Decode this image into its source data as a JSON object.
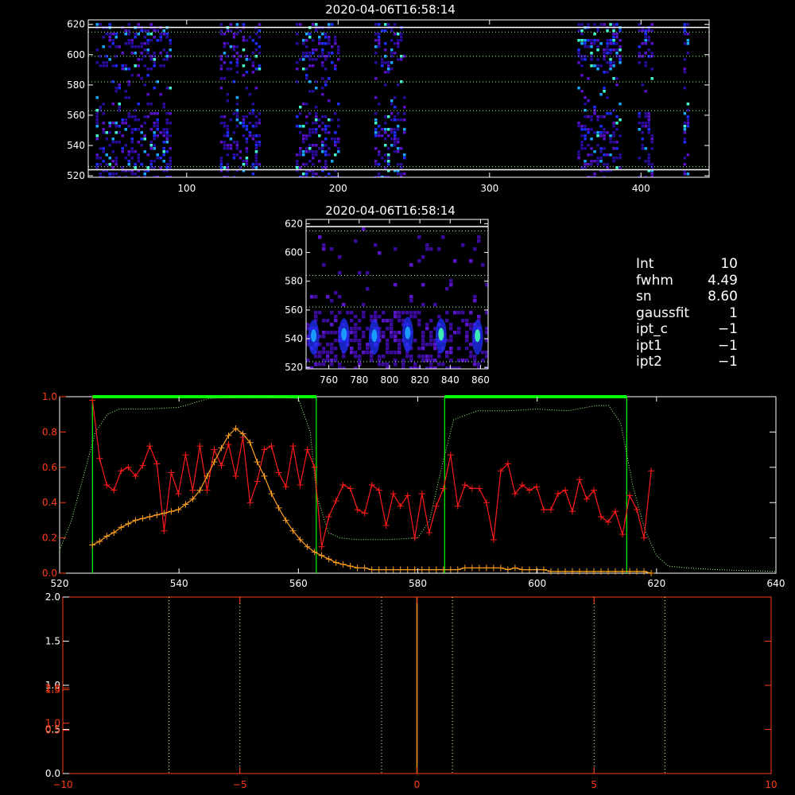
{
  "colors": {
    "white": "#ffffff",
    "red_axis": "#ff3c14",
    "red_series": "#ff1a1a",
    "orange_series": "#ffa01e",
    "green": "#00ff00",
    "grid_dotted": "#ffffa0"
  },
  "panel_top": {
    "title": "2020-04-06T16:58:14",
    "chart_data": {
      "type": "heatmap",
      "xlim": [
        35,
        445
      ],
      "ylim": [
        519,
        623
      ],
      "xticks": [
        100,
        200,
        300,
        400
      ],
      "yticks": [
        520,
        540,
        560,
        580,
        600,
        620
      ],
      "column_bands": [
        [
          40,
          90
        ],
        [
          122,
          148
        ],
        [
          172,
          200
        ],
        [
          224,
          244
        ],
        [
          358,
          386
        ],
        [
          398,
          408
        ],
        [
          428,
          431
        ]
      ],
      "gaps_y": [
        [
          563,
          591
        ]
      ],
      "hlines_solid": [
        618,
        524
      ],
      "hlines_dotted": [
        615,
        599,
        582,
        563,
        526
      ]
    }
  },
  "panel_mid": {
    "title": "2020-04-06T16:58:14",
    "chart_data": {
      "type": "heatmap",
      "xlim": [
        745,
        865
      ],
      "ylim": [
        519,
        623
      ],
      "xticks": [
        760,
        780,
        800,
        820,
        840,
        860
      ],
      "yticks": [
        520,
        540,
        560,
        580,
        600,
        620
      ],
      "bright_spots": [
        [
          750,
          541
        ],
        [
          770,
          542
        ],
        [
          790,
          541
        ],
        [
          812,
          543
        ],
        [
          834,
          542
        ],
        [
          858,
          541
        ]
      ],
      "hlines_solid": [
        618
      ],
      "hlines_dotted": [
        615,
        584,
        562,
        524
      ]
    }
  },
  "info_lines": [
    {
      "key": "Int",
      "val": "10"
    },
    {
      "key": "fwhm",
      "val": "4.49"
    },
    {
      "key": "sn",
      "val": "8.60"
    },
    {
      "key": "gaussfit",
      "val": "1"
    },
    {
      "key": "ipt_c",
      "val": "−1"
    },
    {
      "key": "ipt1",
      "val": "−1"
    },
    {
      "key": "ipt2",
      "val": "−1"
    }
  ],
  "panel_spec": {
    "chart_data": {
      "type": "line",
      "xlim": [
        520,
        640
      ],
      "ylim": [
        0,
        1.0
      ],
      "xticks": [
        520,
        540,
        560,
        580,
        600,
        620,
        640
      ],
      "yticks": [
        0.0,
        0.2,
        0.4,
        0.6,
        0.8,
        1.0
      ],
      "ytick_labels": [
        "0.0",
        "0.2",
        "0.4",
        "0.6",
        "0.8",
        "1.0"
      ],
      "green_windows": [
        [
          525.5,
          563
        ],
        [
          584.5,
          615
        ]
      ],
      "green_dotted": {
        "x": [
          520,
          522,
          524,
          526,
          528,
          530,
          535,
          540,
          545,
          550,
          555,
          560,
          562,
          563,
          565,
          567,
          570,
          575,
          580,
          582,
          584,
          586,
          590,
          595,
          600,
          605,
          610,
          612,
          614,
          616,
          618,
          620,
          622,
          625,
          630,
          640
        ],
        "y": [
          0.13,
          0.3,
          0.55,
          0.8,
          0.9,
          0.93,
          0.93,
          0.94,
          0.99,
          1.0,
          1.0,
          0.99,
          0.8,
          0.45,
          0.23,
          0.2,
          0.19,
          0.19,
          0.2,
          0.3,
          0.6,
          0.87,
          0.92,
          0.92,
          0.93,
          0.92,
          0.95,
          0.95,
          0.85,
          0.5,
          0.25,
          0.1,
          0.04,
          0.03,
          0.02,
          0.01
        ]
      },
      "series": [
        {
          "x": [
            525.5,
            526.7,
            527.9,
            529.1,
            530.3,
            531.5,
            532.7,
            533.9,
            535.1,
            536.3,
            537.5,
            538.7,
            539.9,
            541.1,
            542.3,
            543.5,
            544.7,
            545.9,
            547.1,
            548.3,
            549.5,
            550.7,
            551.9,
            553.1,
            554.3,
            555.5,
            556.7,
            557.9,
            559.1,
            560.3,
            561.5,
            562.7,
            563.9,
            565.1,
            566.3,
            567.5,
            568.7,
            569.9,
            571.1,
            572.3,
            573.5,
            574.7,
            575.9,
            577.1,
            578.3,
            579.5,
            580.7,
            581.9,
            583.1,
            584.3,
            585.5,
            586.7,
            587.9,
            589.1,
            590.3,
            591.5,
            592.7,
            593.9,
            595.1,
            596.3,
            597.5,
            598.7,
            599.9,
            601.1,
            602.3,
            603.5,
            604.7,
            605.9,
            607.1,
            608.3,
            609.5,
            610.7,
            611.9,
            613.1,
            614.3,
            615.5,
            616.7,
            617.9,
            619.1
          ],
          "y": [
            0.98,
            0.65,
            0.5,
            0.47,
            0.58,
            0.6,
            0.55,
            0.61,
            0.72,
            0.62,
            0.24,
            0.57,
            0.45,
            0.67,
            0.47,
            0.72,
            0.47,
            0.7,
            0.61,
            0.73,
            0.55,
            0.77,
            0.4,
            0.52,
            0.7,
            0.72,
            0.57,
            0.49,
            0.72,
            0.5,
            0.7,
            0.6,
            0.15,
            0.32,
            0.41,
            0.5,
            0.48,
            0.36,
            0.34,
            0.5,
            0.47,
            0.27,
            0.45,
            0.38,
            0.44,
            0.2,
            0.45,
            0.23,
            0.38,
            0.48,
            0.67,
            0.38,
            0.5,
            0.48,
            0.48,
            0.4,
            0.19,
            0.58,
            0.62,
            0.45,
            0.5,
            0.47,
            0.49,
            0.36,
            0.36,
            0.45,
            0.47,
            0.35,
            0.53,
            0.42,
            0.47,
            0.32,
            0.29,
            0.35,
            0.22,
            0.44,
            0.36,
            0.2,
            0.58
          ]
        },
        {
          "x": [
            525.5,
            526.7,
            527.9,
            529.1,
            530.3,
            531.5,
            532.7,
            533.9,
            535.1,
            536.3,
            537.5,
            538.7,
            539.9,
            541.1,
            542.3,
            543.5,
            544.7,
            545.9,
            547.1,
            548.3,
            549.5,
            550.7,
            551.9,
            553.1,
            554.3,
            555.5,
            556.7,
            557.9,
            559.1,
            560.3,
            561.5,
            562.7,
            563.9,
            565.1,
            566.3,
            567.5,
            568.7,
            569.9,
            571.1,
            572.3,
            573.5,
            574.7,
            575.9,
            577.1,
            578.3,
            579.5,
            580.7,
            581.9,
            583.1,
            584.3,
            585.5,
            586.7,
            587.9,
            589.1,
            590.3,
            591.5,
            592.7,
            593.9,
            595.1,
            596.3,
            597.5,
            598.7,
            599.9,
            601.1,
            602.3,
            603.5,
            604.7,
            605.9,
            607.1,
            608.3,
            609.5,
            610.7,
            611.9,
            613.1,
            614.3,
            615.5,
            616.7,
            617.9,
            619.1
          ],
          "y": [
            0.16,
            0.18,
            0.21,
            0.23,
            0.26,
            0.28,
            0.3,
            0.31,
            0.32,
            0.33,
            0.34,
            0.35,
            0.36,
            0.39,
            0.42,
            0.47,
            0.55,
            0.63,
            0.71,
            0.78,
            0.82,
            0.79,
            0.74,
            0.63,
            0.55,
            0.45,
            0.37,
            0.3,
            0.24,
            0.19,
            0.15,
            0.12,
            0.1,
            0.08,
            0.06,
            0.05,
            0.04,
            0.03,
            0.03,
            0.02,
            0.02,
            0.02,
            0.02,
            0.02,
            0.02,
            0.02,
            0.02,
            0.02,
            0.02,
            0.02,
            0.02,
            0.02,
            0.03,
            0.03,
            0.03,
            0.03,
            0.03,
            0.03,
            0.02,
            0.03,
            0.02,
            0.02,
            0.02,
            0.02,
            0.01,
            0.01,
            0.01,
            0.01,
            0.01,
            0.01,
            0.01,
            0.01,
            0.01,
            0.01,
            0.01,
            0.01,
            0.01,
            0.01,
            0.0
          ]
        }
      ]
    }
  },
  "panel_low": {
    "chart_data": {
      "type": "line",
      "xlim": [
        -10,
        10
      ],
      "ylim": [
        0,
        2.0
      ],
      "xticks": [
        -10,
        -5,
        0,
        5,
        10
      ],
      "xtick_labels": [
        "−10",
        "−5",
        "0",
        "5",
        "10"
      ],
      "yticks_white": [
        0.0,
        0.5,
        1.0,
        1.5,
        2.0
      ],
      "yticks_white_labels": [
        "0.0",
        "0.5",
        "1.0",
        "1.5",
        "2.0"
      ],
      "yticks_red": [
        0.5,
        1.0,
        1.5,
        2.0
      ],
      "yticks_red_labels": [
        "0.5",
        "1.0",
        "1.5",
        "2.0"
      ],
      "yticks_red_offsets": [
        0.49,
        0.57,
        0.95,
        0.97
      ],
      "vlines_dotted_white": [
        -7,
        -5,
        -1,
        1,
        5,
        7
      ],
      "vline_orange": 0
    }
  }
}
